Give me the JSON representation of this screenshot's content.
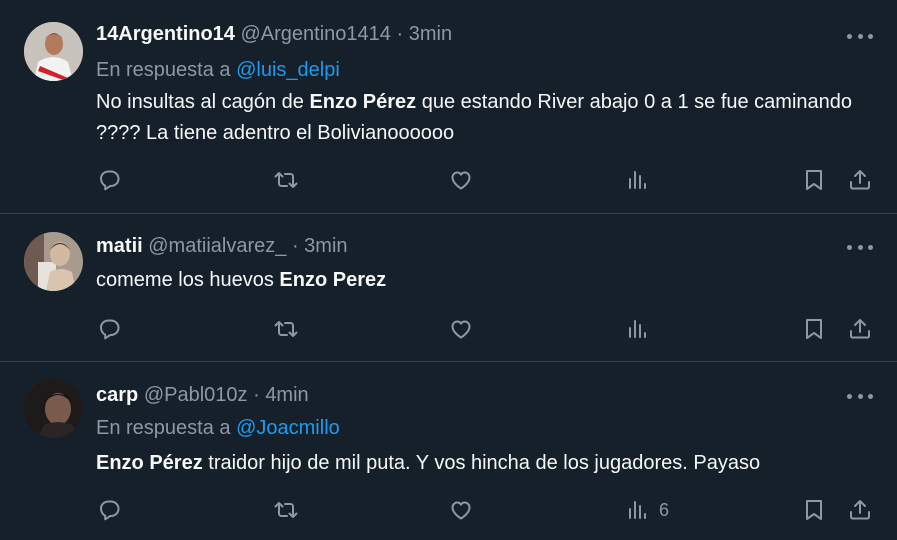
{
  "colors": {
    "background": "#15202b",
    "divider": "#38444d",
    "text_primary": "#f7f9f9",
    "text_secondary": "#8b98a5",
    "link": "#1d9bf0"
  },
  "tweets": [
    {
      "name": "14Argentino14",
      "handle": "@Argentino1414",
      "dot": "·",
      "time": "3min",
      "reply_prefix": "En respuesta a",
      "reply_to": "@luis_delpi",
      "text_segments": [
        {
          "t": "No insultas al cagón de ",
          "bold": false
        },
        {
          "t": "Enzo Pérez",
          "bold": true
        },
        {
          "t": " que estando River abajo 0 a 1 se fue caminando ???? La tiene adentro el Bolivianoooooo",
          "bold": false
        }
      ],
      "views": "",
      "icons": [
        "reply-icon",
        "retweet-icon",
        "like-icon",
        "views-icon",
        "bookmark-icon",
        "share-icon"
      ]
    },
    {
      "name": "matii",
      "handle": "@matiialvarez_",
      "dot": "·",
      "time": "3min",
      "text_segments": [
        {
          "t": "comeme los huevos ",
          "bold": false
        },
        {
          "t": "Enzo Perez",
          "bold": true
        }
      ],
      "views": "",
      "icons": [
        "reply-icon",
        "retweet-icon",
        "like-icon",
        "views-icon",
        "bookmark-icon",
        "share-icon"
      ]
    },
    {
      "name": "carp",
      "handle": "@Pabl010z",
      "dot": "·",
      "time": "4min",
      "reply_prefix": "En respuesta a",
      "reply_to": "@Joacmillo",
      "text_segments": [
        {
          "t": "Enzo Pérez",
          "bold": true
        },
        {
          "t": " traidor hijo de mil puta. Y vos hincha de los jugadores. Payaso",
          "bold": false
        }
      ],
      "views": "6",
      "icons": [
        "reply-icon",
        "retweet-icon",
        "like-icon",
        "views-icon",
        "bookmark-icon",
        "share-icon"
      ]
    }
  ]
}
